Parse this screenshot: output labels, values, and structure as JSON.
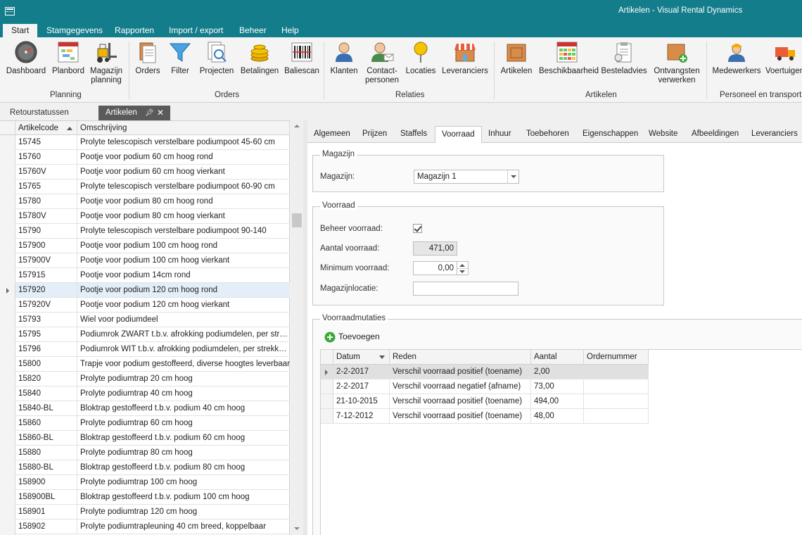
{
  "window": {
    "title": "Artikelen - Visual Rental Dynamics"
  },
  "menu": [
    "Start",
    "Stamgegevens",
    "Rapporten",
    "Import / export",
    "Beheer",
    "Help"
  ],
  "ribbon": {
    "buttons": {
      "dashboard": "Dashboard",
      "planbord": "Planbord",
      "magazijn_planning_1": "Magazijn",
      "magazijn_planning_2": "planning",
      "orders": "Orders",
      "filter": "Filter",
      "projecten": "Projecten",
      "betalingen": "Betalingen",
      "baliescan": "Baliescan",
      "klanten": "Klanten",
      "contactpersonen_1": "Contact-",
      "contactpersonen_2": "personen",
      "locaties": "Locaties",
      "leveranciers": "Leveranciers",
      "artikelen": "Artikelen",
      "beschikbaarheid": "Beschikbaarheid",
      "besteladvies": "Besteladvies",
      "ontvangsten_1": "Ontvangsten",
      "ontvangsten_2": "verwerken",
      "medewerkers": "Medewerkers",
      "voertuigen": "Voertuigen"
    },
    "groups": {
      "planning": "Planning",
      "orders": "Orders",
      "relaties": "Relaties",
      "artikelen": "Artikelen",
      "personeel": "Personeel en transport"
    }
  },
  "doc_tabs": {
    "inactive": "Retourstatussen",
    "active": "Artikelen"
  },
  "grid": {
    "columns": {
      "code": "Artikelcode",
      "desc": "Omschrijving"
    },
    "selected_index": 10,
    "rows": [
      {
        "code": "15745",
        "desc": "Prolyte telescopisch verstelbare podiumpoot 45-60 cm"
      },
      {
        "code": "15760",
        "desc": "Pootje voor podium 60 cm hoog rond"
      },
      {
        "code": "15760V",
        "desc": "Pootje voor podium 60 cm hoog vierkant"
      },
      {
        "code": "15765",
        "desc": "Prolyte telescopisch verstelbare podiumpoot 60-90 cm"
      },
      {
        "code": "15780",
        "desc": "Pootje voor podium 80 cm hoog rond"
      },
      {
        "code": "15780V",
        "desc": "Pootje voor podium 80 cm hoog vierkant"
      },
      {
        "code": "15790",
        "desc": "Prolyte telescopisch verstelbare podiumpoot 90-140"
      },
      {
        "code": "157900",
        "desc": "Pootje voor podium 100 cm hoog rond"
      },
      {
        "code": "157900V",
        "desc": "Pootje voor podium 100 cm hoog vierkant"
      },
      {
        "code": "157915",
        "desc": "Pootje voor podium 14cm rond"
      },
      {
        "code": "157920",
        "desc": "Pootje voor podium 120 cm hoog rond"
      },
      {
        "code": "157920V",
        "desc": "Pootje voor podium 120 cm hoog vierkant"
      },
      {
        "code": "15793",
        "desc": "Wiel voor podiumdeel"
      },
      {
        "code": "15795",
        "desc": "Podiumrok ZWART t.b.v. afrokking podiumdelen, per strek..."
      },
      {
        "code": "15796",
        "desc": "Podiumrok WIT t.b.v. afrokking podiumdelen, per strekke..."
      },
      {
        "code": "15800",
        "desc": "Trapje voor podium gestoffeerd, diverse hoogtes leverbaar"
      },
      {
        "code": "15820",
        "desc": "Prolyte podiumtrap 20 cm hoog"
      },
      {
        "code": "15840",
        "desc": "Prolyte podiumtrap 40 cm hoog"
      },
      {
        "code": "15840-BL",
        "desc": "Bloktrap gestoffeerd t.b.v. podium 40 cm hoog"
      },
      {
        "code": "15860",
        "desc": "Prolyte podiumtrap 60 cm hoog"
      },
      {
        "code": "15860-BL",
        "desc": "Bloktrap gestoffeerd t.b.v. podium 60 cm hoog"
      },
      {
        "code": "15880",
        "desc": "Prolyte podiumtrap 80 cm hoog"
      },
      {
        "code": "15880-BL",
        "desc": "Bloktrap gestoffeerd t.b.v. podium 80 cm hoog"
      },
      {
        "code": "158900",
        "desc": "Prolyte podiumtrap 100 cm hoog"
      },
      {
        "code": "158900BL",
        "desc": "Bloktrap gestoffeerd t.b.v. podium 100 cm hoog"
      },
      {
        "code": "158901",
        "desc": "Prolyte podiumtrap 120 cm hoog"
      },
      {
        "code": "158902",
        "desc": "Prolyte podiumtrapleuning 40 cm breed, koppelbaar"
      }
    ]
  },
  "detail_tabs": [
    "Algemeen",
    "Prijzen",
    "Staffels",
    "Voorraad",
    "Inhuur",
    "Toebehoren",
    "Eigenschappen",
    "Website",
    "Afbeeldingen",
    "Leveranciers"
  ],
  "detail_active_tab": "Voorraad",
  "magazijn": {
    "legend": "Magazijn",
    "label": "Magazijn:",
    "value": "Magazijn 1"
  },
  "voorraad": {
    "legend": "Voorraad",
    "beheer_label": "Beheer voorraad:",
    "beheer_checked": true,
    "aantal_label": "Aantal voorraad:",
    "aantal_value": "471,00",
    "minimum_label": "Minimum voorraad:",
    "minimum_value": "0,00",
    "locatie_label": "Magazijnlocatie:",
    "locatie_value": ""
  },
  "mutaties": {
    "legend": "Voorraadmutaties",
    "add_label": "Toevoegen",
    "columns": {
      "datum": "Datum",
      "reden": "Reden",
      "aantal": "Aantal",
      "ordernummer": "Ordernummer"
    },
    "rows": [
      {
        "datum": "2-2-2017",
        "reden": "Verschil voorraad positief (toename)",
        "aantal": "2,00",
        "ordernummer": ""
      },
      {
        "datum": "2-2-2017",
        "reden": "Verschil voorraad negatief (afname)",
        "aantal": "73,00",
        "ordernummer": ""
      },
      {
        "datum": "21-10-2015",
        "reden": "Verschil voorraad positief (toename)",
        "aantal": "494,00",
        "ordernummer": ""
      },
      {
        "datum": "7-12-2012",
        "reden": "Verschil voorraad positief (toename)",
        "aantal": "48,00",
        "ordernummer": ""
      }
    ]
  },
  "colors": {
    "titlebar": "#137d8b",
    "selected_row": "#e4eef8",
    "tab_active_doc": "#5a5a5a"
  }
}
